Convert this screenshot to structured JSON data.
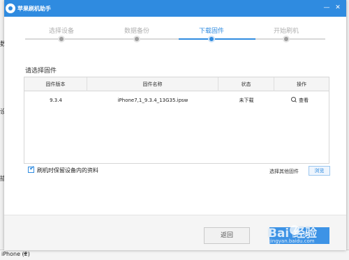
{
  "background_app": {
    "side_letters": [
      "数",
      "设",
      "插"
    ],
    "bottom_tab": "iPhone (2)",
    "bottom_tab_arrow": "⏶"
  },
  "dialog": {
    "title": "苹果刷机助手",
    "window_controls": [
      "—",
      "✕"
    ],
    "steps": [
      {
        "label": "选择设备",
        "state": "done"
      },
      {
        "label": "数据备份",
        "state": "done"
      },
      {
        "label": "下载固件",
        "state": "current"
      },
      {
        "label": "开始刷机",
        "state": "pending"
      }
    ],
    "section_label": "请选择固件",
    "table": {
      "columns": [
        "固件版本",
        "固件名称",
        "状态",
        "操作"
      ],
      "rows": [
        {
          "version": "9.3.4",
          "name": "iPhone7,1_9.3.4_13G35.ipsw",
          "status": "未下载",
          "action": "查看"
        }
      ]
    },
    "keep_data_checkbox": {
      "label": "刷机时保留设备内的资料",
      "checked": true
    },
    "other_firmware_label": "选择其他固件",
    "browse_label": "浏览",
    "back_label": "返回",
    "next_label": "下一步"
  },
  "watermark": {
    "text": "Bai 经验",
    "sub": "jingyan.baidu.com"
  },
  "colors": {
    "accent": "#2f8be0",
    "inactive_step": "#b0b0b0"
  }
}
